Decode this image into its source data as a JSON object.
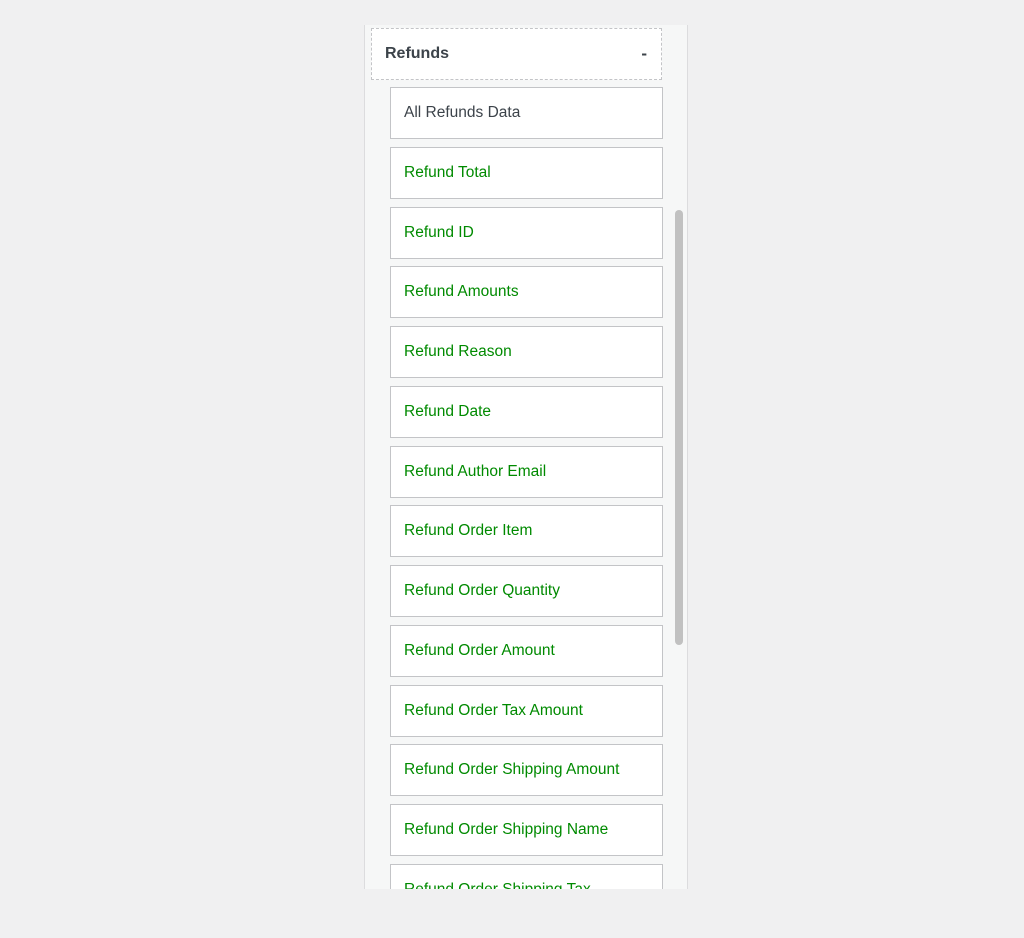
{
  "section": {
    "title": "Refunds",
    "toggle": "-"
  },
  "fields": [
    {
      "label": "All Refunds Data",
      "kind": "all"
    },
    {
      "label": "Refund Total",
      "kind": "field"
    },
    {
      "label": "Refund ID",
      "kind": "field"
    },
    {
      "label": "Refund Amounts",
      "kind": "field"
    },
    {
      "label": "Refund Reason",
      "kind": "field"
    },
    {
      "label": "Refund Date",
      "kind": "field"
    },
    {
      "label": "Refund Author Email",
      "kind": "field"
    },
    {
      "label": "Refund Order Item",
      "kind": "field"
    },
    {
      "label": "Refund Order Quantity",
      "kind": "field"
    },
    {
      "label": "Refund Order Amount",
      "kind": "field"
    },
    {
      "label": "Refund Order Tax Amount",
      "kind": "field"
    },
    {
      "label": "Refund Order Shipping Amount",
      "kind": "field"
    },
    {
      "label": "Refund Order Shipping Name",
      "kind": "field"
    },
    {
      "label": "Refund Order Shipping Tax",
      "kind": "field"
    }
  ],
  "colors": {
    "field_text": "#008a00",
    "all_text": "#3c434a",
    "background": "#f0f0f1"
  }
}
